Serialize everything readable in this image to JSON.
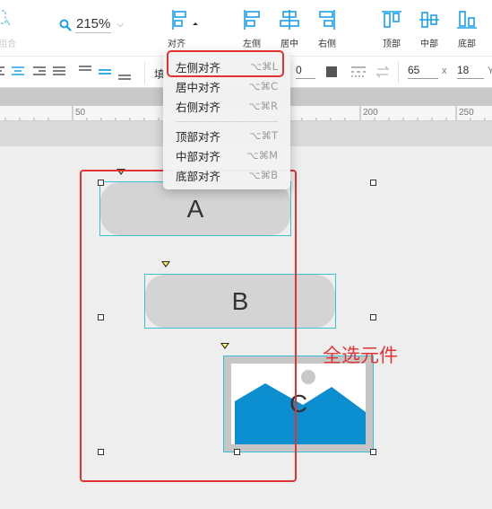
{
  "toolbar": {
    "ungroup_label": "组合",
    "zoom_value": "215%",
    "align_label": "对齐",
    "left_label": "左侧",
    "center_label": "居中",
    "right_label": "右侧",
    "top_label": "顶部",
    "middle_label": "中部",
    "bottom_label": "底部"
  },
  "style_bar": {
    "fill_label": "填",
    "stroke_width": "0",
    "width_value": "65",
    "x_label": "x",
    "height_value": "18",
    "y_label": "Y"
  },
  "ruler": {
    "marks": [
      "50",
      "200",
      "250"
    ]
  },
  "align_menu": {
    "items": [
      {
        "label": "左侧对齐",
        "shortcut": "⌥⌘L"
      },
      {
        "label": "居中对齐",
        "shortcut": "⌥⌘C"
      },
      {
        "label": "右侧对齐",
        "shortcut": "⌥⌘R"
      },
      {
        "label": "顶部对齐",
        "shortcut": "⌥⌘T"
      },
      {
        "label": "中部对齐",
        "shortcut": "⌥⌘M"
      },
      {
        "label": "底部对齐",
        "shortcut": "⌥⌘B"
      }
    ]
  },
  "canvas": {
    "shape_a": "A",
    "shape_b": "B",
    "shape_c": "C",
    "annotation": "全选元件"
  },
  "colors": {
    "accent": "#1aa1e6",
    "selection": "#38c2d3",
    "highlight": "#e53131",
    "image_fill": "#0b8fd1"
  }
}
